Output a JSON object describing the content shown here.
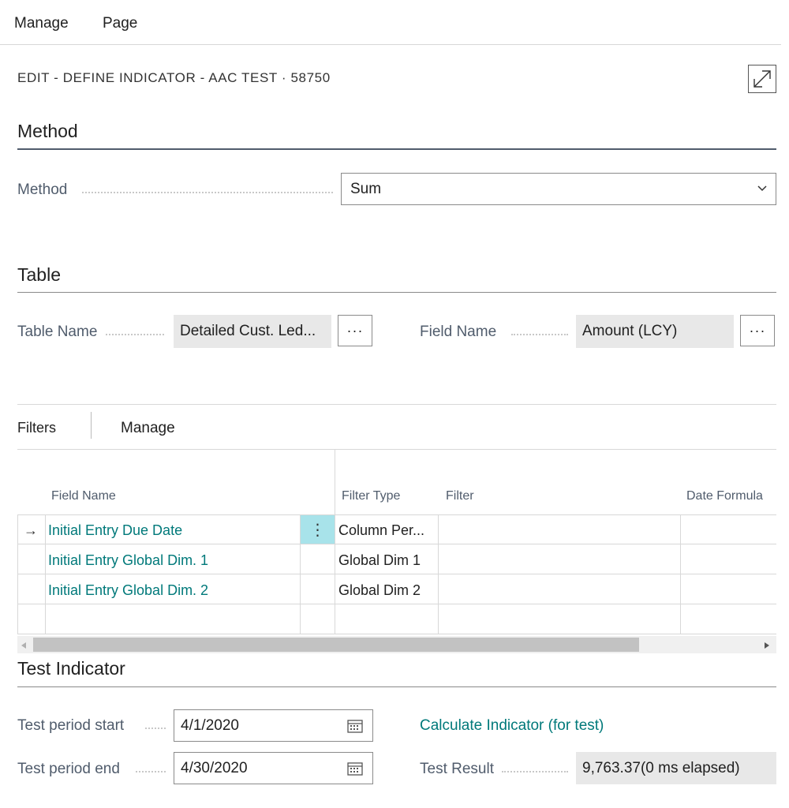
{
  "menu": {
    "manage": "Manage",
    "page": "Page"
  },
  "page_title": "EDIT - DEFINE INDICATOR - AAC TEST · 58750",
  "method_section": {
    "heading": "Method",
    "method_label": "Method",
    "method_value": "Sum"
  },
  "table_section": {
    "heading": "Table",
    "table_name_label": "Table Name",
    "table_name_value": "Detailed Cust. Led...",
    "field_name_label": "Field Name",
    "field_name_value": "Amount (LCY)",
    "ellipsis": "···"
  },
  "filters": {
    "tab_filters": "Filters",
    "tab_manage": "Manage",
    "columns": {
      "field_name": "Field Name",
      "filter_type": "Filter Type",
      "filter": "Filter",
      "date_formula": "Date Formula"
    },
    "rows": [
      {
        "field_name": "Initial Entry Due Date",
        "filter_type": "Column Per...",
        "filter": "",
        "date_formula": ""
      },
      {
        "field_name": "Initial Entry Global Dim. 1",
        "filter_type": "Global Dim 1",
        "filter": "",
        "date_formula": ""
      },
      {
        "field_name": "Initial Entry Global Dim. 2",
        "filter_type": "Global Dim 2",
        "filter": "",
        "date_formula": ""
      }
    ],
    "row_arrow": "→",
    "row_menu": "⋮"
  },
  "test_section": {
    "heading": "Test Indicator",
    "start_label": "Test period start",
    "start_value": "4/1/2020",
    "end_label": "Test period end",
    "end_value": "4/30/2020",
    "calculate_link": "Calculate Indicator (for test)",
    "result_label": "Test Result",
    "result_value": "9,763.37(0 ms elapsed)"
  },
  "colors": {
    "accent": "#00797a",
    "selected_cell": "#a8e3ea",
    "readonly_bg": "#e8e8e8"
  },
  "icons": [
    "expand-icon",
    "chevron-down-icon",
    "calendar-icon",
    "scroll-left-icon",
    "scroll-right-icon"
  ]
}
